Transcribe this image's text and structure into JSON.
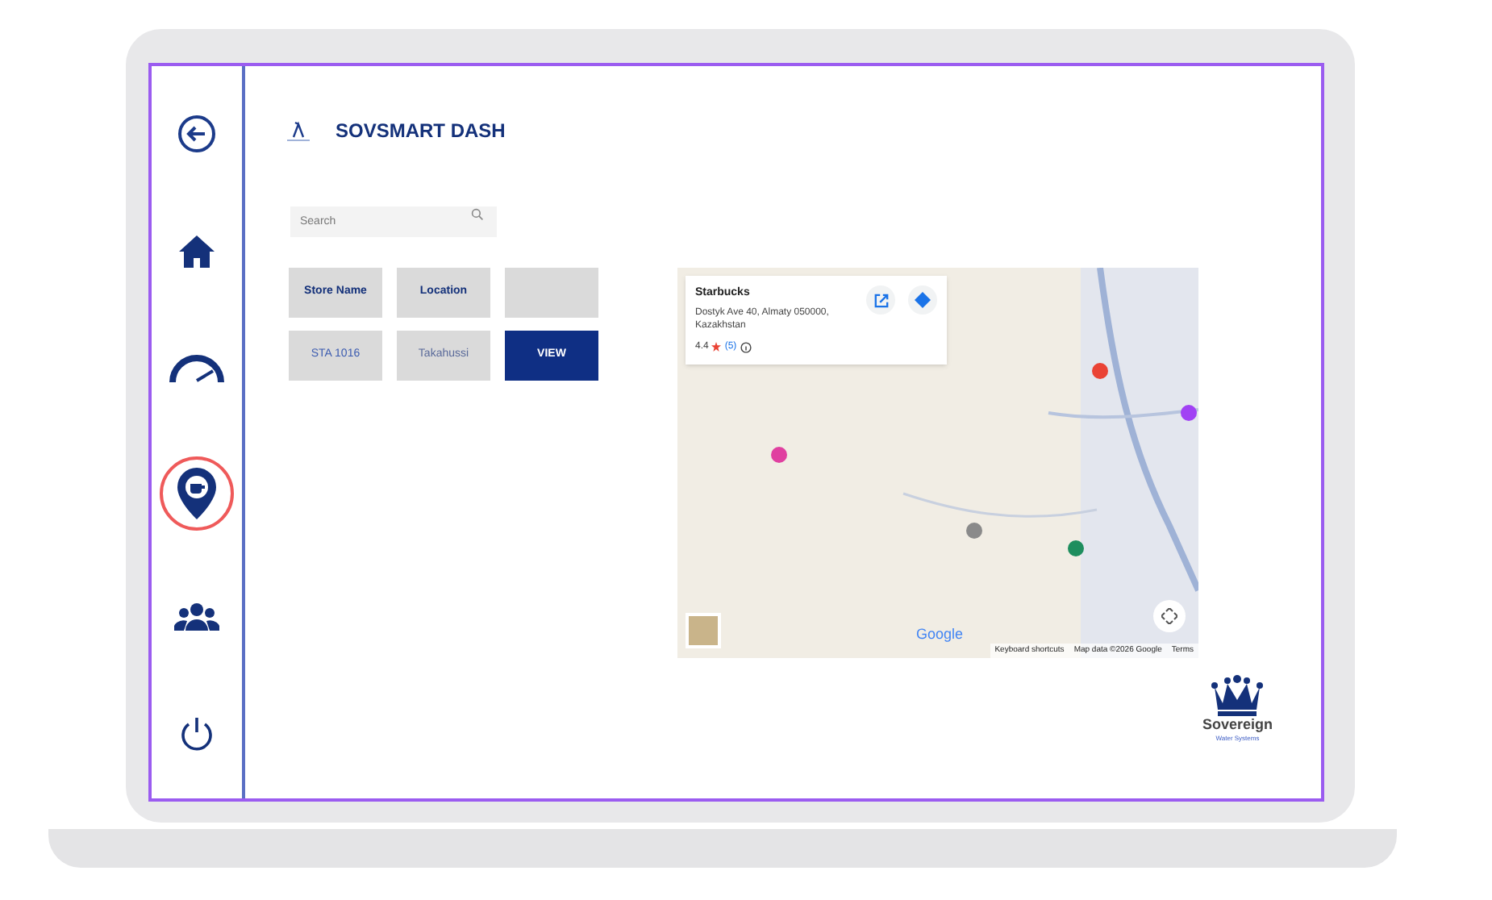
{
  "sidebar": {
    "items": [
      {
        "kind": "back",
        "selected": false
      },
      {
        "kind": "home",
        "selected": false
      },
      {
        "kind": "gauge",
        "selected": false
      },
      {
        "kind": "store-pin",
        "selected": true
      },
      {
        "kind": "users",
        "selected": false
      },
      {
        "kind": "power",
        "selected": false
      }
    ]
  },
  "header": {
    "title": "SOVSMART DASH"
  },
  "search": {
    "placeholder": "Search"
  },
  "table": {
    "columns": [
      "Store Name",
      "Location"
    ],
    "rows": [
      {
        "store_name": "STA 1016",
        "location": "Takahussi",
        "action": "VIEW"
      }
    ]
  },
  "map": {
    "info_card": {
      "title": "Starbucks",
      "address": "Dostyk Ave 40, Almaty 050000, Kazakhstan",
      "rating": "4.4",
      "review_count": "(5)"
    },
    "logo": "Google",
    "attribution": [
      "Keyboard shortcuts",
      "Map data ©2026 Google",
      "Terms"
    ]
  },
  "brand": {
    "name": "Sovereign",
    "tagline": "Water Systems"
  }
}
